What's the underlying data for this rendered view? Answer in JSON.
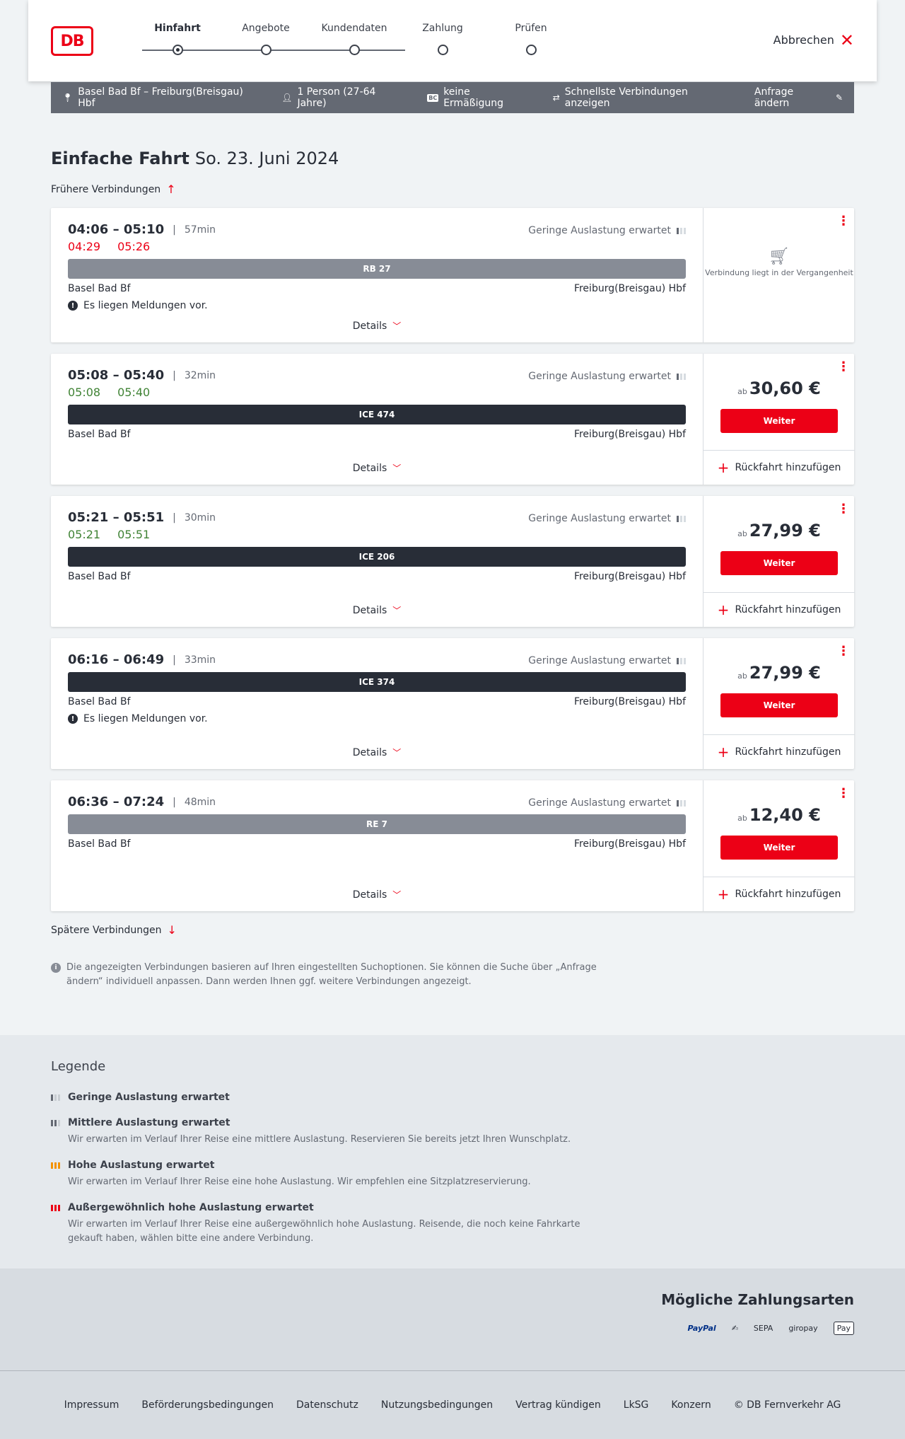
{
  "header": {
    "logo": "DB",
    "steps": [
      "Hinfahrt",
      "Angebote",
      "Kundendaten",
      "Zahlung",
      "Prüfen"
    ],
    "cancel": "Abbrechen"
  },
  "infobar": {
    "route": "Basel Bad Bf – Freiburg(Breisgau) Hbf",
    "persons": "1 Person (27-64 Jahre)",
    "discount_badge": "BC",
    "discount": "keine Ermäßigung",
    "fastest": "Schnellste Verbindungen anzeigen",
    "change": "Anfrage ändern"
  },
  "title": {
    "type": "Einfache Fahrt",
    "date": "So. 23. Juni 2024"
  },
  "earlier": "Frühere Verbindungen",
  "later": "Spätere Verbindungen",
  "load_label": "Geringe Auslastung erwartet",
  "details_label": "Details",
  "weiter_label": "Weiter",
  "rueck_label": "Rückfahrt hinzufügen",
  "price_prefix": "ab",
  "notice_text": "Es liegen Meldungen vor.",
  "past_text": "Verbindung liegt in der Vergangenheit",
  "connections": [
    {
      "times": "04:06 – 05:10",
      "duration": "57min",
      "rt_dep": "04:29",
      "rt_arr": "05:26",
      "train": "RB 27",
      "from": "Basel Bad Bf",
      "to": "Freiburg(Breisgau) Hbf",
      "price": ""
    },
    {
      "times": "05:08 – 05:40",
      "duration": "32min",
      "rt_dep": "05:08",
      "rt_arr": "05:40",
      "train": "ICE 474",
      "from": "Basel Bad Bf",
      "to": "Freiburg(Breisgau) Hbf",
      "price": "30,60 €"
    },
    {
      "times": "05:21 – 05:51",
      "duration": "30min",
      "rt_dep": "05:21",
      "rt_arr": "05:51",
      "train": "ICE 206",
      "from": "Basel Bad Bf",
      "to": "Freiburg(Breisgau) Hbf",
      "price": "27,99 €"
    },
    {
      "times": "06:16 – 06:49",
      "duration": "33min",
      "train": "ICE 374",
      "from": "Basel Bad Bf",
      "to": "Freiburg(Breisgau) Hbf",
      "price": "27,99 €"
    },
    {
      "times": "06:36 – 07:24",
      "duration": "48min",
      "train": "RE 7",
      "from": "Basel Bad Bf",
      "to": "Freiburg(Breisgau) Hbf",
      "price": "12,40 €"
    }
  ],
  "hint": "Die angezeigten Verbindungen basieren auf Ihren eingestellten Suchoptionen. Sie können die Suche über „Anfrage ändern“ individuell anpassen. Dann werden Ihnen ggf. weitere Verbindungen angezeigt.",
  "legend": {
    "title": "Legende",
    "items": [
      {
        "title": "Geringe Auslastung erwartet",
        "desc": ""
      },
      {
        "title": "Mittlere Auslastung erwartet",
        "desc": "Wir erwarten im Verlauf Ihrer Reise eine mittlere Auslastung. Reservieren Sie bereits jetzt Ihren Wunschplatz."
      },
      {
        "title": "Hohe Auslastung erwartet",
        "desc": "Wir erwarten im Verlauf Ihrer Reise eine hohe Auslastung. Wir empfehlen eine Sitzplatzreservierung."
      },
      {
        "title": "Außergewöhnlich hohe Auslastung erwartet",
        "desc": "Wir erwarten im Verlauf Ihrer Reise eine außergewöhnlich hohe Auslastung. Reisende, die noch keine Fahrkarte gekauft haben, wählen bitte eine andere Verbindung."
      }
    ]
  },
  "payment": {
    "title": "Mögliche Zahlungsarten",
    "paypal": "PayPal",
    "sepa": "SEPA",
    "giropay": "giropay",
    "applepay": "Pay"
  },
  "footer": [
    "Impressum",
    "Beförderungsbedingungen",
    "Datenschutz",
    "Nutzungsbedingungen",
    "Vertrag kündigen",
    "LkSG",
    "Konzern",
    "© DB Fernverkehr AG"
  ],
  "colors": {
    "accent": "#ec0016",
    "ontime": "#408335",
    "dark": "#282d37"
  }
}
